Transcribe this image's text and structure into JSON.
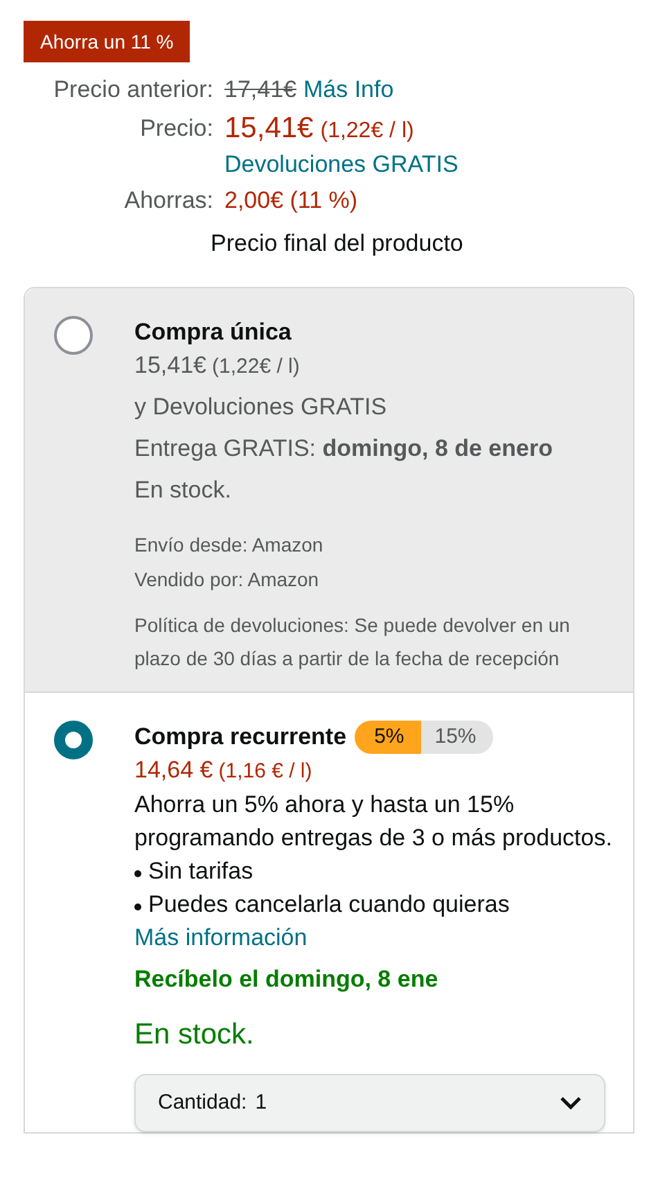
{
  "badge": "Ahorra un 11 %",
  "price_rows": [
    {
      "kind": "old",
      "label": "Precio anterior:",
      "value": "17,41€",
      "link": "Más Info"
    },
    {
      "kind": "current",
      "label": "Precio:",
      "value": "15,41€",
      "unit": "(1,22€ / l)",
      "link": "Devoluciones GRATIS"
    },
    {
      "kind": "savings",
      "label": "Ahorras:",
      "value": "2,00€ (11 %)"
    }
  ],
  "final_note": "Precio final del producto",
  "options": [
    {
      "kind": "one_time",
      "selected": false,
      "title": "Compra única",
      "price": "15,41€",
      "unit": "(1,22€ / l)",
      "returns": "y Devoluciones GRATIS",
      "delivery": "Entrega GRATIS: **domingo, 8 de enero**",
      "stock": "En stock.",
      "seller_lines": [
        "Envío desde: Amazon",
        "Vendido por: Amazon"
      ],
      "policy": "Política de devoluciones: Se puede devolver en un plazo de 30 días a partir de la fecha de recepción"
    },
    {
      "kind": "subscribe",
      "selected": true,
      "title": "Compra recurrente",
      "tiers": [
        {
          "label": "5%",
          "selected": true
        },
        {
          "label": "15%",
          "selected": false
        }
      ],
      "price": "14,64 €",
      "unit": "(1,16 € / l)",
      "description": "Ahorra un 5% ahora y hasta un 15% programando entregas de 3 o más productos.",
      "bullets": [
        "Sin tarifas",
        "Puedes cancelarla cuando quieras"
      ],
      "link": "Más información",
      "delivery_message": "Recíbelo el domingo, 8 ene",
      "stock": "En stock.",
      "quantity": {
        "label": "Cantidad:",
        "value": "1"
      }
    }
  ]
}
